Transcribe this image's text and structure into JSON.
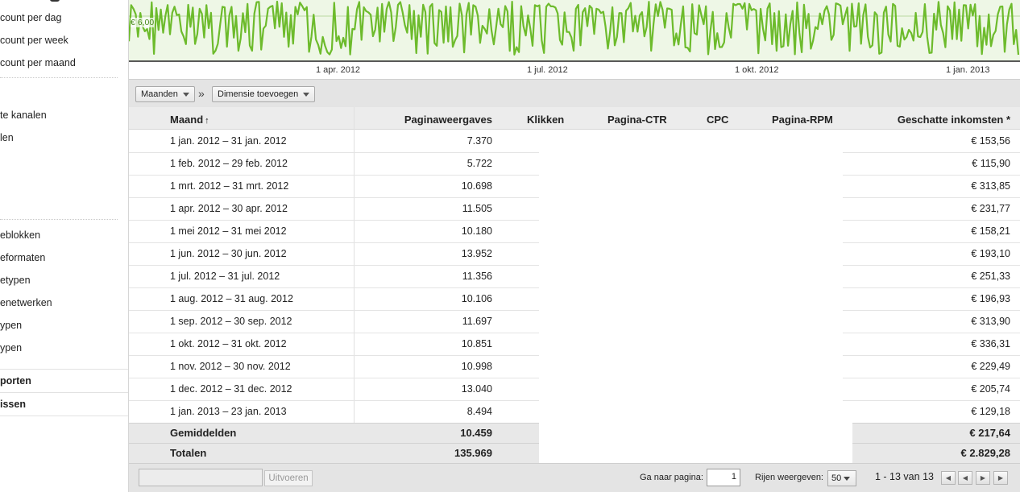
{
  "sidebar": {
    "items": [
      {
        "label": "count per dag"
      },
      {
        "label": "count per week"
      },
      {
        "label": "count per maand"
      },
      {
        "label": "te kanalen"
      },
      {
        "label": "len"
      },
      {
        "label": "eblokken"
      },
      {
        "label": "eformaten"
      },
      {
        "label": "etypen"
      },
      {
        "label": "enetwerken"
      },
      {
        "label": "ypen"
      },
      {
        "label": "ypen"
      }
    ],
    "sections": [
      {
        "label": "porten"
      },
      {
        "label": "issen"
      }
    ]
  },
  "chart": {
    "y_marker_label": "€ 6,00",
    "x_ticks": [
      "1 apr. 2012",
      "1 jul. 2012",
      "1 okt. 2012",
      "1 jan. 2013"
    ],
    "line_color": "#6dbb2c",
    "fill_color": "#eef7e6"
  },
  "toolbar": {
    "dimension_select": "Maanden",
    "separator": "»",
    "add_dimension_label": "Dimensie toevoegen"
  },
  "table": {
    "columns": [
      "Maand",
      "Paginaweergaves",
      "Klikken",
      "Pagina-CTR",
      "CPC",
      "Pagina-RPM",
      "Geschatte inkomsten *"
    ],
    "sort_indicator": "↑",
    "rows": [
      {
        "month": "1 jan. 2012 – 31 jan. 2012",
        "views": "7.370",
        "income": "€ 153,56"
      },
      {
        "month": "1 feb. 2012 – 29 feb. 2012",
        "views": "5.722",
        "income": "€ 115,90"
      },
      {
        "month": "1 mrt. 2012 – 31 mrt. 2012",
        "views": "10.698",
        "income": "€ 313,85"
      },
      {
        "month": "1 apr. 2012 – 30 apr. 2012",
        "views": "11.505",
        "income": "€ 231,77"
      },
      {
        "month": "1 mei 2012 – 31 mei 2012",
        "views": "10.180",
        "income": "€ 158,21"
      },
      {
        "month": "1 jun. 2012 – 30 jun. 2012",
        "views": "13.952",
        "income": "€ 193,10"
      },
      {
        "month": "1 jul. 2012 – 31 jul. 2012",
        "views": "11.356",
        "income": "€ 251,33"
      },
      {
        "month": "1 aug. 2012 – 31 aug. 2012",
        "views": "10.106",
        "income": "€ 196,93"
      },
      {
        "month": "1 sep. 2012 – 30 sep. 2012",
        "views": "11.697",
        "income": "€ 313,90"
      },
      {
        "month": "1 okt. 2012 – 31 okt. 2012",
        "views": "10.851",
        "income": "€ 336,31"
      },
      {
        "month": "1 nov. 2012 – 30 nov. 2012",
        "views": "10.998",
        "income": "€ 229,49"
      },
      {
        "month": "1 dec. 2012 – 31 dec. 2012",
        "views": "13.040",
        "income": "€ 205,74"
      },
      {
        "month": "1 jan. 2013 – 23 jan. 2013",
        "views": "8.494",
        "income": "€ 129,18"
      }
    ],
    "averages": {
      "label": "Gemiddelden",
      "views": "10.459",
      "income": "€ 217,64"
    },
    "totals": {
      "label": "Totalen",
      "views": "135.969",
      "income": "€ 2.829,28"
    }
  },
  "footer": {
    "execute_label": "Uitvoeren",
    "goto_label": "Ga naar pagina:",
    "page_value": "1",
    "rows_label": "Rijen weergeven:",
    "rows_value": "50",
    "range_text": "1 - 13 van 13"
  }
}
